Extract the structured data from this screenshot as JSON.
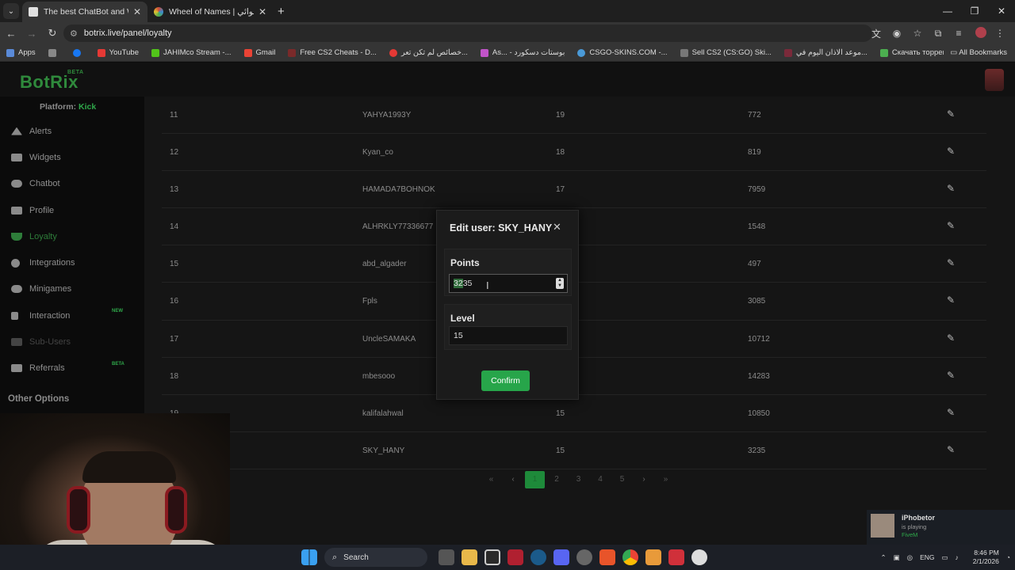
{
  "browser": {
    "tabs": [
      {
        "title": "The best ChatBot and Widgets",
        "favicon_color": "#e0e0e0",
        "active": true
      },
      {
        "title": "Wheel of Names | اسم العشوائي",
        "favicon_color": "#d04a3a",
        "active": false
      }
    ],
    "url": "botrix.live/panel/loyalty",
    "bookmarks": [
      {
        "label": "Apps",
        "color": "#5a8ad8"
      },
      {
        "label": "",
        "color": "#1877f2"
      },
      {
        "label": "YouTube",
        "color": "#e53935"
      },
      {
        "label": "JAHIMco Stream -...",
        "color": "#52c41a"
      },
      {
        "label": "Gmail",
        "color": "#ea4335"
      },
      {
        "label": "Free CS2 Cheats - D...",
        "color": "#7a2a2a"
      },
      {
        "label": "خصائص لم تكن تعر...",
        "color": "#e53935"
      },
      {
        "label": "As... - بوستات دسكورد",
        "color": "#c054c8"
      },
      {
        "label": "CSGO-SKINS.COM -...",
        "color": "#4a9ad8"
      },
      {
        "label": "Sell CS2 (CS:GO) Ski...",
        "color": "#777777"
      },
      {
        "label": "موعد الاذان اليوم في...",
        "color": "#7a2a3a"
      },
      {
        "label": "Скачать торрент р...",
        "color": "#4caf50"
      }
    ],
    "all_bookmarks": "All Bookmarks",
    "window_controls": [
      "—",
      "❐",
      "✕"
    ]
  },
  "app": {
    "logo": "BotRix",
    "logo_badge": "BETA",
    "platform_label": "Platform:",
    "platform_value": "Kick",
    "sidebar": [
      {
        "label": "Alerts",
        "state": "normal",
        "badge": ""
      },
      {
        "label": "Widgets",
        "state": "normal",
        "badge": ""
      },
      {
        "label": "Chatbot",
        "state": "normal",
        "badge": ""
      },
      {
        "label": "Profile",
        "state": "normal",
        "badge": ""
      },
      {
        "label": "Loyalty",
        "state": "active",
        "badge": ""
      },
      {
        "label": "Integrations",
        "state": "normal",
        "badge": ""
      },
      {
        "label": "Minigames",
        "state": "normal",
        "badge": ""
      },
      {
        "label": "Interaction",
        "state": "normal",
        "badge": "NEW"
      },
      {
        "label": "Sub-Users",
        "state": "dim",
        "badge": ""
      },
      {
        "label": "Referrals",
        "state": "normal",
        "badge": "BETA"
      }
    ],
    "other_options": "Other Options"
  },
  "table": {
    "rows": [
      {
        "rank": "11",
        "name": "YAHYA1993Y",
        "level": "19",
        "points": "772"
      },
      {
        "rank": "12",
        "name": "Kyan_co",
        "level": "18",
        "points": "819"
      },
      {
        "rank": "13",
        "name": "HAMADA7BOHNOK",
        "level": "17",
        "points": "7959"
      },
      {
        "rank": "14",
        "name": "ALHRKLY77336677",
        "level": "",
        "points": "1548"
      },
      {
        "rank": "15",
        "name": "abd_algader",
        "level": "",
        "points": "497"
      },
      {
        "rank": "16",
        "name": "Fpls",
        "level": "",
        "points": "3085"
      },
      {
        "rank": "17",
        "name": "UncleSAMAKA",
        "level": "",
        "points": "10712"
      },
      {
        "rank": "18",
        "name": "mbesooo",
        "level": "",
        "points": "14283"
      },
      {
        "rank": "19",
        "name": "kalifalahwal",
        "level": "15",
        "points": "10850"
      },
      {
        "rank": "",
        "name": "SKY_HANY",
        "level": "15",
        "points": "3235"
      }
    ],
    "edit_icon": "✎"
  },
  "pagination": {
    "first": "«",
    "prev": "‹",
    "pages": [
      "1",
      "2",
      "3",
      "4",
      "5"
    ],
    "current": "1",
    "next": "›",
    "last": "»"
  },
  "modal": {
    "title": "Edit user: SKY_HANY",
    "close": "✕",
    "points_label": "Points",
    "points_selected": "32",
    "points_rest": "35",
    "level_label": "Level",
    "level_value": "15",
    "confirm": "Confirm"
  },
  "notification": {
    "name": "iPhobetor",
    "status": "is playing",
    "game": "FiveM"
  },
  "taskbar": {
    "search": "Search",
    "lang": "ENG",
    "time": "8:46 PM",
    "date": "2/1/2026"
  }
}
